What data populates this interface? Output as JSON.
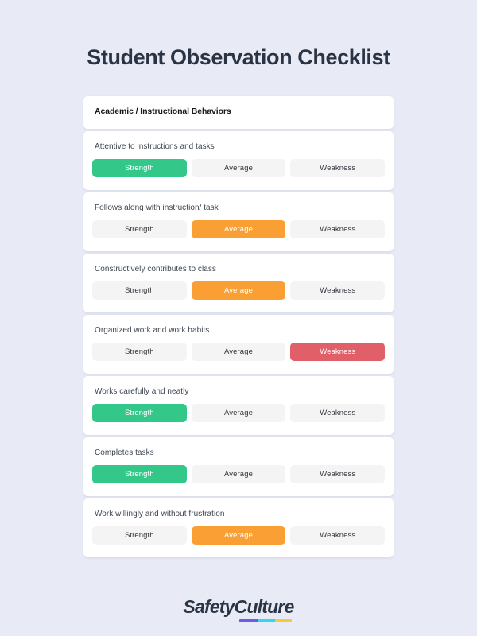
{
  "page": {
    "title": "Student Observation Checklist",
    "background_color": "#e8ebf5",
    "title_color": "#2b3445"
  },
  "section": {
    "header": "Academic / Instructional Behaviors"
  },
  "options_legend": {
    "strength": "Strength",
    "average": "Average",
    "weakness": "Weakness"
  },
  "colors": {
    "strength": "#34c78a",
    "average": "#f99f33",
    "weakness": "#e05f69",
    "unselected_bg": "#f4f4f5",
    "unselected_text": "#33363c",
    "card_bg": "#ffffff"
  },
  "rows": [
    {
      "label": "Attentive to instructions and tasks",
      "options": [
        "Strength",
        "Average",
        "Weakness"
      ],
      "selected": "Strength"
    },
    {
      "label": "Follows along with instruction/ task",
      "options": [
        "Strength",
        "Average",
        "Weakness"
      ],
      "selected": "Average"
    },
    {
      "label": "Constructively contributes to class",
      "options": [
        "Strength",
        "Average",
        "Weakness"
      ],
      "selected": "Average"
    },
    {
      "label": "Organized work and work habits",
      "options": [
        "Strength",
        "Average",
        "Weakness"
      ],
      "selected": "Weakness"
    },
    {
      "label": "Works carefully and neatly",
      "options": [
        "Strength",
        "Average",
        "Weakness"
      ],
      "selected": "Strength"
    },
    {
      "label": "Completes tasks",
      "options": [
        "Strength",
        "Average",
        "Weakness"
      ],
      "selected": "Strength"
    },
    {
      "label": "Work willingly and without frustration",
      "options": [
        "Strength",
        "Average",
        "Weakness"
      ],
      "selected": "Average"
    }
  ],
  "footer": {
    "logo_part_one": "Safety",
    "logo_part_two": "Culture",
    "underline_colors": [
      "#6c5ce7",
      "#2ed9f0",
      "#f5c842"
    ]
  }
}
